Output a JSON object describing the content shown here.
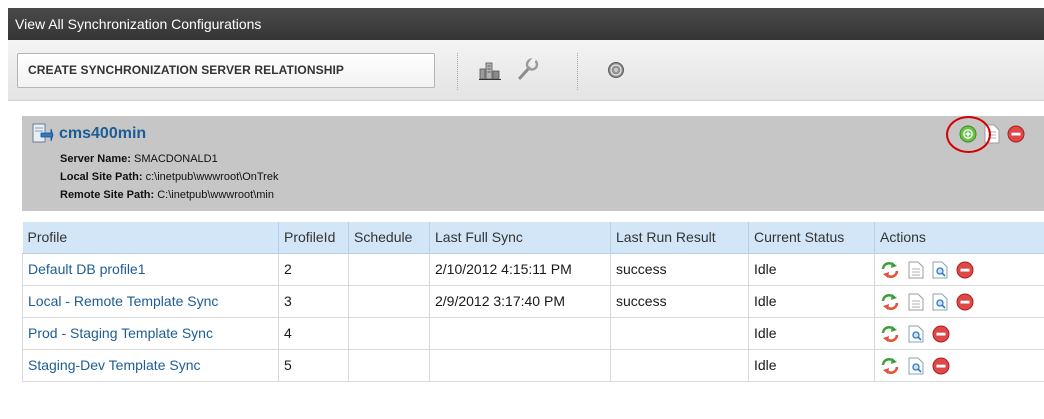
{
  "window": {
    "title": "View All Synchronization Configurations"
  },
  "toolbar": {
    "create_label": "CREATE SYNCHRONIZATION SERVER RELATIONSHIP",
    "icons": [
      "statistics-icon",
      "wrench-icon",
      "help-icon"
    ]
  },
  "server": {
    "name": "cms400min",
    "server_name_label": "Server Name:",
    "server_name": "SMACDONALD1",
    "local_path_label": "Local Site Path:",
    "local_path": "c:\\inetpub\\wwwroot\\OnTrek",
    "remote_path_label": "Remote Site Path:",
    "remote_path": "C:\\inetpub\\wwwroot\\min",
    "actions": [
      "add-profile-icon",
      "document-icon",
      "delete-icon"
    ],
    "colors": {
      "accent": "#1d5d95",
      "panel": "#c6c6c6",
      "highlight": "#d40000"
    }
  },
  "table": {
    "headers": [
      "Profile",
      "ProfileId",
      "Schedule",
      "Last Full Sync",
      "Last Run Result",
      "Current Status",
      "Actions"
    ],
    "rows": [
      {
        "profile": "Default DB profile1",
        "id": "2",
        "schedule": "",
        "last_sync": "2/10/2012 4:15:11 PM",
        "result": "success",
        "status": "Idle",
        "actions": [
          "sync-icon",
          "document-icon",
          "preview-icon",
          "delete-icon"
        ]
      },
      {
        "profile": "Local - Remote Template Sync",
        "id": "3",
        "schedule": "",
        "last_sync": "2/9/2012 3:17:40 PM",
        "result": "success",
        "status": "Idle",
        "actions": [
          "sync-icon",
          "document-icon",
          "preview-icon",
          "delete-icon"
        ]
      },
      {
        "profile": "Prod - Staging Template Sync",
        "id": "4",
        "schedule": "",
        "last_sync": "",
        "result": "",
        "status": "Idle",
        "actions": [
          "sync-icon",
          "preview-icon",
          "delete-icon"
        ]
      },
      {
        "profile": "Staging-Dev Template Sync",
        "id": "5",
        "schedule": "",
        "last_sync": "",
        "result": "",
        "status": "Idle",
        "actions": [
          "sync-icon",
          "preview-icon",
          "delete-icon"
        ]
      }
    ]
  }
}
